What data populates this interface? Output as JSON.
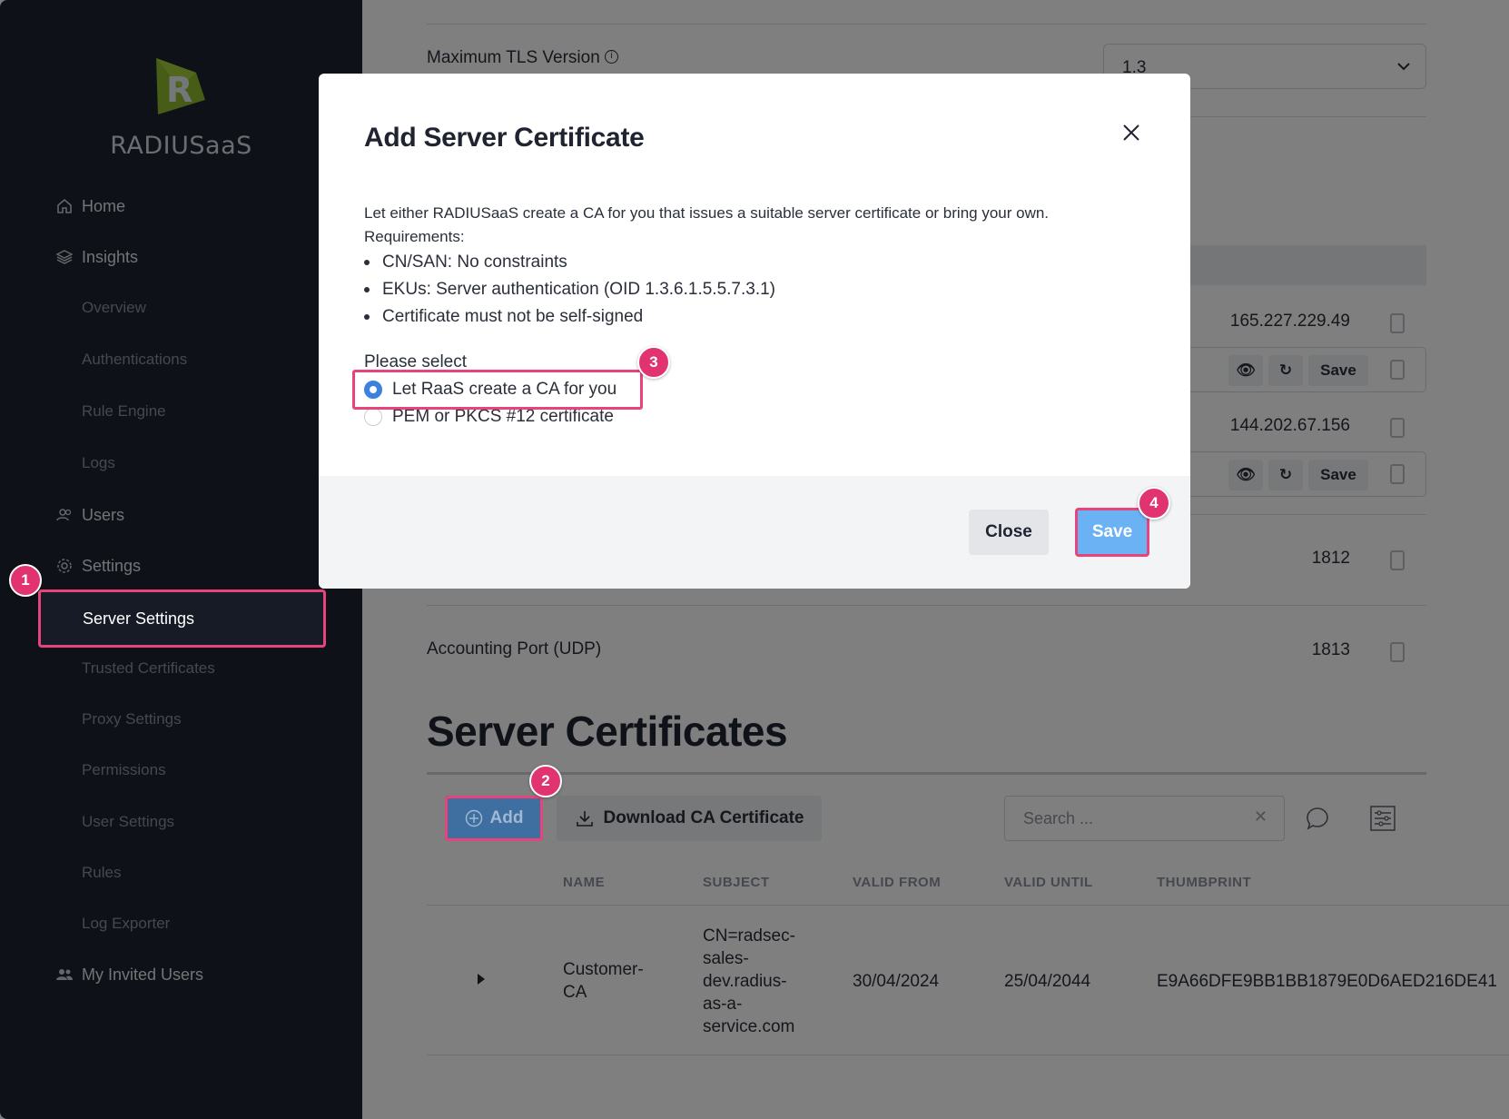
{
  "app": {
    "brand": "RADIUSaaS"
  },
  "sidebar": {
    "items": [
      {
        "label": "Home",
        "icon": "home-icon"
      },
      {
        "label": "Insights",
        "icon": "layers-icon"
      },
      {
        "label": "Overview",
        "external": true
      },
      {
        "label": "Authentications",
        "external": true
      },
      {
        "label": "Rule Engine",
        "external": true
      },
      {
        "label": "Logs",
        "external": true
      },
      {
        "label": "Users",
        "icon": "users-icon"
      },
      {
        "label": "Settings",
        "icon": "gear-icon"
      },
      {
        "label": "Server Settings",
        "active": true
      },
      {
        "label": "Trusted Certificates"
      },
      {
        "label": "Proxy Settings"
      },
      {
        "label": "Permissions"
      },
      {
        "label": "User Settings"
      },
      {
        "label": "Rules"
      },
      {
        "label": "Log Exporter"
      },
      {
        "label": "My Invited Users",
        "icon": "group-icon"
      }
    ]
  },
  "main": {
    "tls": {
      "label": "Maximum TLS Version",
      "value": "1.3"
    },
    "servers": [
      {
        "ip": "165.227.229.49"
      },
      {
        "ip": "144.202.67.156"
      }
    ],
    "action_save": "Save",
    "auth_port": {
      "value": "1812"
    },
    "acct_port": {
      "label": "Accounting Port (UDP)",
      "value": "1813"
    },
    "certs": {
      "title": "Server Certificates",
      "add_label": "Add",
      "download_label": "Download CA Certificate",
      "search_placeholder": "Search ...",
      "columns": [
        "NAME",
        "SUBJECT",
        "VALID FROM",
        "VALID UNTIL",
        "THUMBPRINT"
      ],
      "rows": [
        {
          "name_lines": [
            "Customer-",
            "CA"
          ],
          "subject_lines": [
            "CN=radsec-",
            "sales-",
            "dev.radius-",
            "as-a-",
            "service.com"
          ],
          "valid_from": "30/04/2024",
          "valid_until": "25/04/2044",
          "thumbprint": "E9A66DFE9BB1BB1879E0D6AED216DE41"
        }
      ]
    }
  },
  "modal": {
    "title": "Add Server Certificate",
    "description": "Let either RADIUSaaS create a CA for you that issues a suitable server certificate or bring your own.",
    "requirements_label": "Requirements:",
    "requirements": [
      "CN/SAN: No constraints",
      "EKUs: Server authentication (OID 1.3.6.1.5.5.7.3.1)",
      "Certificate must not be self-signed"
    ],
    "select_label": "Please select",
    "options": [
      {
        "label": "Let RaaS create a CA for you",
        "selected": true
      },
      {
        "label": "PEM or PKCS #12 certificate",
        "selected": false
      }
    ],
    "close_label": "Close",
    "save_label": "Save"
  },
  "badges": [
    "1",
    "2",
    "3",
    "4"
  ],
  "colors": {
    "sidebar_bg": "#1e2330",
    "accent_blue": "#4f97e0",
    "highlight_pink": "#e8437a"
  }
}
